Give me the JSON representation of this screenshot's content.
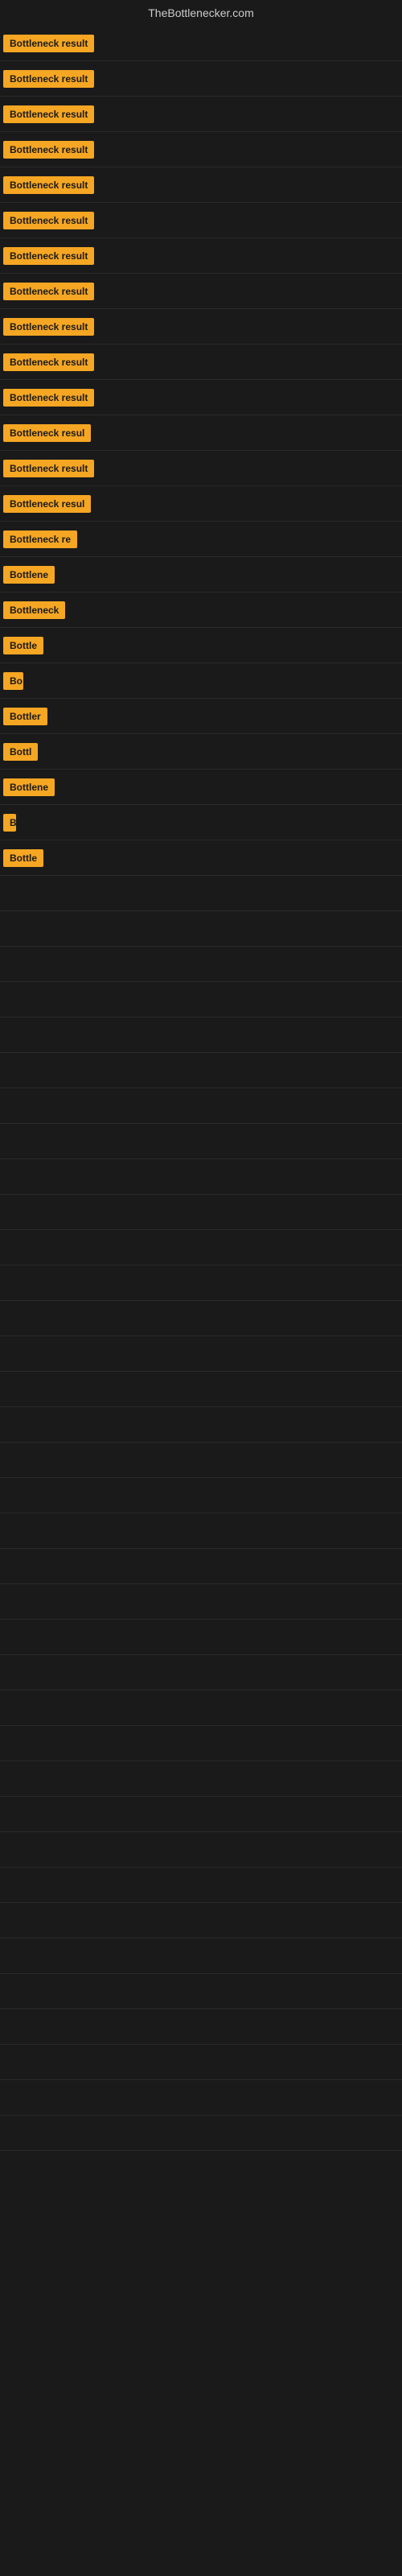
{
  "site": {
    "title": "TheBottlenecker.com"
  },
  "badges": [
    {
      "id": 1,
      "label": "Bottleneck result",
      "width": "full"
    },
    {
      "id": 2,
      "label": "Bottleneck result",
      "width": "full"
    },
    {
      "id": 3,
      "label": "Bottleneck result",
      "width": "full"
    },
    {
      "id": 4,
      "label": "Bottleneck result",
      "width": "full"
    },
    {
      "id": 5,
      "label": "Bottleneck result",
      "width": "full"
    },
    {
      "id": 6,
      "label": "Bottleneck result",
      "width": "full"
    },
    {
      "id": 7,
      "label": "Bottleneck result",
      "width": "full"
    },
    {
      "id": 8,
      "label": "Bottleneck result",
      "width": "full"
    },
    {
      "id": 9,
      "label": "Bottleneck result",
      "width": "full"
    },
    {
      "id": 10,
      "label": "Bottleneck result",
      "width": "full"
    },
    {
      "id": 11,
      "label": "Bottleneck result",
      "width": "full"
    },
    {
      "id": 12,
      "label": "Bottleneck resul",
      "width": "partial-1"
    },
    {
      "id": 13,
      "label": "Bottleneck result",
      "width": "full"
    },
    {
      "id": 14,
      "label": "Bottleneck resul",
      "width": "partial-1"
    },
    {
      "id": 15,
      "label": "Bottleneck re",
      "width": "partial-2"
    },
    {
      "id": 16,
      "label": "Bottlene",
      "width": "partial-3"
    },
    {
      "id": 17,
      "label": "Bottleneck",
      "width": "partial-4"
    },
    {
      "id": 18,
      "label": "Bottle",
      "width": "partial-5"
    },
    {
      "id": 19,
      "label": "Bo",
      "width": "partial-6"
    },
    {
      "id": 20,
      "label": "Bottler",
      "width": "partial-7"
    },
    {
      "id": 21,
      "label": "Bottl",
      "width": "partial-8"
    },
    {
      "id": 22,
      "label": "Bottlene",
      "width": "partial-3"
    },
    {
      "id": 23,
      "label": "B",
      "width": "partial-9"
    },
    {
      "id": 24,
      "label": "Bottle",
      "width": "partial-5"
    }
  ]
}
